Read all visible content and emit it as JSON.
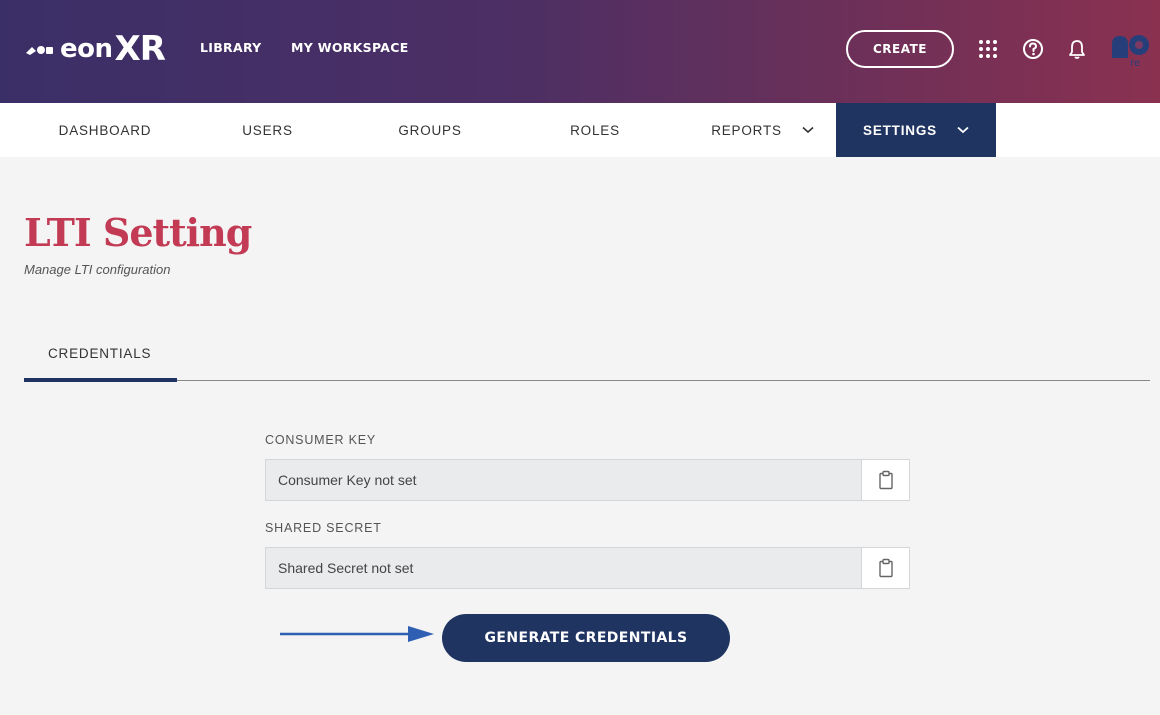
{
  "header": {
    "logo_text": "eon",
    "logo_xr": "XR",
    "nav": [
      {
        "label": "LIBRARY"
      },
      {
        "label": "MY WORKSPACE"
      }
    ],
    "create_label": "CREATE",
    "icons": [
      "apps-grid-icon",
      "help-icon",
      "bell-icon",
      "avatar"
    ],
    "avatar_initials": "re"
  },
  "subnav": {
    "items": [
      {
        "label": "DASHBOARD"
      },
      {
        "label": "USERS"
      },
      {
        "label": "GROUPS"
      },
      {
        "label": "ROLES"
      },
      {
        "label": "REPORTS"
      },
      {
        "label": "SETTINGS"
      }
    ]
  },
  "page": {
    "title": "LTI Setting",
    "subtitle": "Manage LTI configuration"
  },
  "tabs": [
    {
      "label": "CREDENTIALS",
      "active": true
    }
  ],
  "form": {
    "consumer_key_label": "CONSUMER KEY",
    "consumer_key_value": "Consumer Key not set",
    "shared_secret_label": "SHARED SECRET",
    "shared_secret_value": "Shared Secret not set",
    "generate_label": "GENERATE CREDENTIALS"
  },
  "colors": {
    "brand_navy": "#1f3461",
    "title_red": "#c33a55",
    "arrow_blue": "#2f5fb3"
  }
}
